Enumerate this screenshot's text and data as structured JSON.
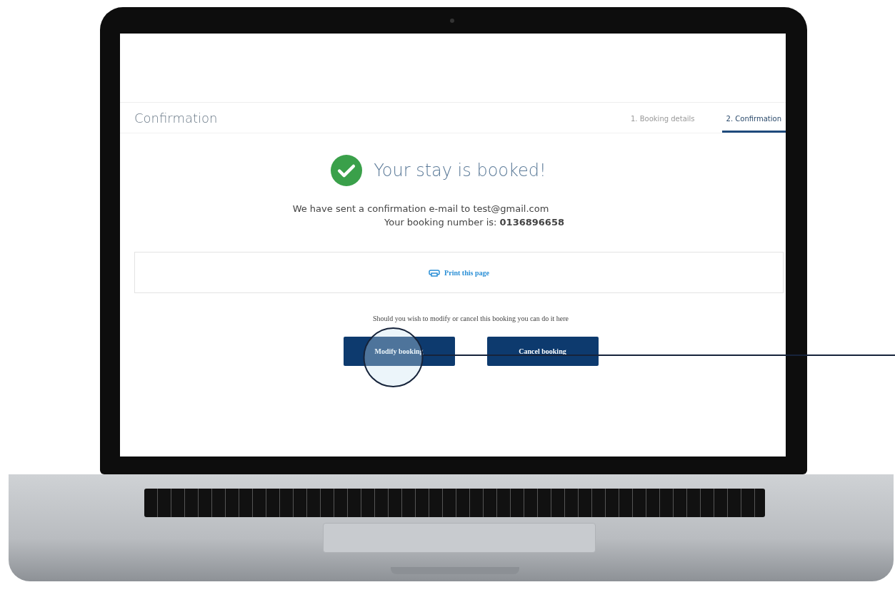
{
  "header": {
    "title": "Confirmation"
  },
  "steps": [
    {
      "label": "1. Booking details",
      "selected": false
    },
    {
      "label": "2. Confirmation",
      "selected": true
    }
  ],
  "success": {
    "heading": "Your stay is booked!",
    "email_line": "We have sent a confirmation e-mail to test@gmail.com",
    "booking_line": "Your booking number is: **0136896658**"
  },
  "print": {
    "label": "Print this page"
  },
  "modify_note": "Should you wish to modify or cancel this booking you can do it here",
  "buttons": [
    {
      "label": "Modify booking",
      "highlighted": true
    },
    {
      "label": "Cancel booking",
      "highlighted": false
    }
  ]
}
